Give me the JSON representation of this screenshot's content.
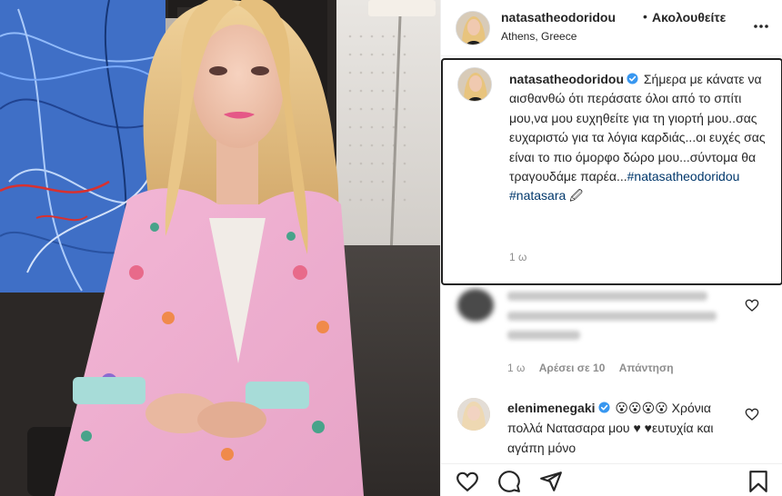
{
  "post": {
    "username": "natasatheodoridou",
    "follow_dot": "•",
    "follow_state": "Ακολουθείτε",
    "location": "Athens, Greece"
  },
  "caption": {
    "username": "natasatheodoridou",
    "body": "Σήμερα με κάνατε να αισθανθώ ότι περάσατε όλοι από το σπίτι μου,να μου ευχηθείτε για τη γιορτή μου..σας ευχαριστώ για τα λόγια καρδιάς...οι ευχές σας είναι το πιο όμορφο δώρο μου...σύντομα θα τραγουδάμε παρέα...",
    "hashtag_1": "#natasatheodoridou",
    "hashtag_2": "#natasara",
    "emoji": "🖉",
    "time": "1 ω"
  },
  "comments": [
    {
      "time": "1 ω",
      "likes": "Αρέσει σε 10",
      "reply": "Απάντηση"
    },
    {
      "username": "elenimenegaki",
      "emojis": "😮😮😮😮",
      "text": "Χρόνια πολλά Νατασαρα μου ♥ ♥ευτυχία και αγάπη μόνο"
    }
  ],
  "icons": {
    "more": "more-options-icon",
    "verified": "verified-badge-icon",
    "like": "heart-icon",
    "comment": "comment-icon",
    "share": "paper-plane-icon",
    "save": "bookmark-icon"
  },
  "colors": {
    "verified": "#3897f0",
    "hashtag": "#00376b",
    "muted": "#8e8e8e",
    "text": "#262626"
  }
}
